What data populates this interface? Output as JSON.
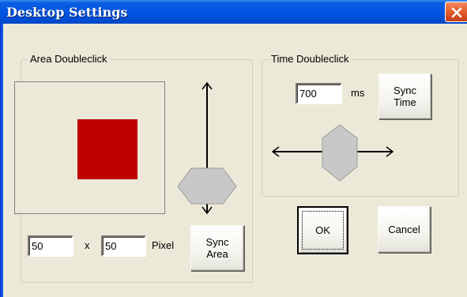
{
  "window": {
    "title": "Desktop Settings"
  },
  "area_group": {
    "label": "Area Doubleclick",
    "width_value": "50",
    "times": "x",
    "height_value": "50",
    "unit": "Pixel",
    "sync_button": "Sync\nArea"
  },
  "time_group": {
    "label": "Time Doubleclick",
    "time_value": "700",
    "unit": "ms",
    "sync_button": "Sync\nTime"
  },
  "buttons": {
    "ok": "OK",
    "cancel": "Cancel"
  },
  "colors": {
    "target_area": "#C00000",
    "titlebar": "#0054E3",
    "slider_thumb": "#C8C8C8"
  },
  "icons": {
    "close": "close-icon"
  }
}
